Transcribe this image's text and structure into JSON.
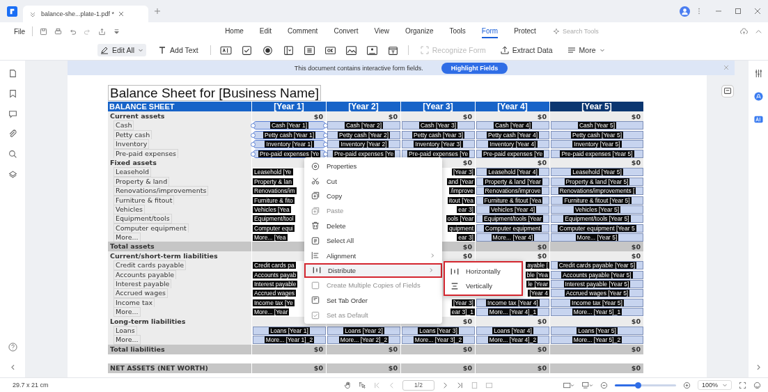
{
  "tab_title": "balance-she...plate-1.pdf *",
  "file_menu": "File",
  "menu": [
    {
      "label": "Home",
      "selected": false
    },
    {
      "label": "Edit",
      "selected": false
    },
    {
      "label": "Comment",
      "selected": false
    },
    {
      "label": "Convert",
      "selected": false
    },
    {
      "label": "View",
      "selected": false
    },
    {
      "label": "Organize",
      "selected": false
    },
    {
      "label": "Tools",
      "selected": false
    },
    {
      "label": "Form",
      "selected": true
    },
    {
      "label": "Protect",
      "selected": false
    }
  ],
  "search": {
    "placeholder": "Search Tools"
  },
  "toolbar": {
    "edit_all": "Edit All",
    "add_text": "Add Text",
    "recognize_form": {
      "label": "Recognize Form",
      "disabled": true
    },
    "extract_data": "Extract Data",
    "more": "More"
  },
  "notice": {
    "text": "This document contains interactive form fields.",
    "button": "Highlight Fields"
  },
  "document": {
    "title": "Balance Sheet for [Business Name]",
    "header": [
      "BALANCE SHEET",
      "[Year 1]",
      "[Year 2]",
      "[Year 3]",
      "[Year 4]",
      "[Year 5]"
    ],
    "rows": [
      {
        "kind": "section",
        "label": "Current assets",
        "values": [
          "$0",
          "$0",
          "$0",
          "$0",
          "$0"
        ]
      },
      {
        "kind": "item",
        "label": "Cash",
        "fields": [
          {
            "kind": "full",
            "text": "Cash [Year 1]",
            "selected": true
          },
          {
            "kind": "full",
            "text": "Cash [Year 2]",
            "selected": false
          },
          {
            "kind": "full",
            "text": "Cash [Year 3]",
            "selected": false
          },
          {
            "kind": "full",
            "text": "Cash [Year 4]",
            "selected": false
          },
          {
            "kind": "full",
            "text": "Cash [Year 5]",
            "selected": false
          }
        ]
      },
      {
        "kind": "item",
        "label": "Petty cash",
        "fields": [
          {
            "kind": "full",
            "text": "Petty cash [Year 1]",
            "selected": true
          },
          {
            "kind": "full",
            "text": "Petty cash [Year 2]",
            "selected": false
          },
          {
            "kind": "full",
            "text": "Petty cash [Year 3]",
            "selected": false
          },
          {
            "kind": "full",
            "text": "Petty cash [Year 4]",
            "selected": false
          },
          {
            "kind": "full",
            "text": "Petty cash [Year 5]",
            "selected": false
          }
        ]
      },
      {
        "kind": "item",
        "label": "Inventory",
        "fields": [
          {
            "kind": "full",
            "text": "Inventory [Year 1]",
            "selected": true
          },
          {
            "kind": "full",
            "text": "Inventory [Year 2]",
            "selected": false
          },
          {
            "kind": "full",
            "text": "Inventory [Year 3]",
            "selected": false
          },
          {
            "kind": "full",
            "text": "Inventory [Year 4]",
            "selected": false
          },
          {
            "kind": "full",
            "text": "Inventory [Year 5]",
            "selected": false
          }
        ]
      },
      {
        "kind": "item",
        "label": "Pre-paid expenses",
        "fields": [
          {
            "kind": "full",
            "text": "Pre-paid expenses [Ye",
            "selected": true
          },
          {
            "kind": "full",
            "text": "Pre-paid expenses [Ye",
            "selected": false
          },
          {
            "kind": "full",
            "text": "Pre-paid expenses [Ye",
            "selected": false
          },
          {
            "kind": "full",
            "text": "Pre-paid expenses [Ye",
            "selected": false
          },
          {
            "kind": "full",
            "text": "Pre-paid expenses [Year 5]",
            "selected": false
          }
        ]
      },
      {
        "kind": "section",
        "label": "Fixed assets",
        "values": [
          "$0",
          "$0",
          "$0"
        ]
      },
      {
        "kind": "item",
        "label": "Leasehold",
        "fields": [
          {
            "kind": "cut-end",
            "text": "Leasehold [Ye",
            "selected": false
          },
          {
            "kind": "covered"
          },
          {
            "kind": "cut-start",
            "text": "[Year 3]",
            "selected": false
          },
          {
            "kind": "full",
            "text": "Leasehold [Year 4]",
            "selected": false
          },
          {
            "kind": "full",
            "text": "Leasehold [Year 5]",
            "selected": false
          }
        ]
      },
      {
        "kind": "item",
        "label": "Property & land",
        "fields": [
          {
            "kind": "cut-end",
            "text": "Property & lan",
            "selected": false
          },
          {
            "kind": "covered"
          },
          {
            "kind": "cut-start",
            "text": "and [Year",
            "selected": false
          },
          {
            "kind": "full",
            "text": "Property & land [Year",
            "selected": false
          },
          {
            "kind": "full",
            "text": "Property & land [Year 5]",
            "selected": false
          }
        ]
      },
      {
        "kind": "item",
        "label": "Renovations/improvements",
        "fields": [
          {
            "kind": "cut-end",
            "text": "Renovations/im",
            "selected": false
          },
          {
            "kind": "covered"
          },
          {
            "kind": "cut-start",
            "text": "/improve",
            "selected": false
          },
          {
            "kind": "full",
            "text": "Renovations/improve",
            "selected": false
          },
          {
            "kind": "full",
            "text": "Renovations/improvements [",
            "selected": false
          }
        ]
      },
      {
        "kind": "item",
        "label": "Furniture & fitout",
        "fields": [
          {
            "kind": "cut-end",
            "text": "Furniture & fito",
            "selected": false
          },
          {
            "kind": "covered"
          },
          {
            "kind": "cut-start",
            "text": "itout [Yea",
            "selected": false
          },
          {
            "kind": "full",
            "text": "Furniture & fitout [Yea",
            "selected": false
          },
          {
            "kind": "full",
            "text": "Furniture & fitout [Year 5]",
            "selected": false
          }
        ]
      },
      {
        "kind": "item",
        "label": "Vehicles",
        "fields": [
          {
            "kind": "cut-end",
            "text": "Vehicles [Yea",
            "selected": false
          },
          {
            "kind": "covered"
          },
          {
            "kind": "cut-start",
            "text": "ear 3]",
            "selected": false
          },
          {
            "kind": "full",
            "text": "Vehicles [Year 4]",
            "selected": false
          },
          {
            "kind": "full",
            "text": "Vehicles [Year 5]",
            "selected": false
          }
        ]
      },
      {
        "kind": "item",
        "label": "Equipment/tools",
        "fields": [
          {
            "kind": "cut-end",
            "text": "Equipment/tool",
            "selected": false
          },
          {
            "kind": "covered"
          },
          {
            "kind": "cut-start",
            "text": "ools [Year",
            "selected": false
          },
          {
            "kind": "full",
            "text": "Equipment/tools [Year",
            "selected": false
          },
          {
            "kind": "full",
            "text": "Equipment/tools [Year 5]",
            "selected": false
          }
        ]
      },
      {
        "kind": "item",
        "label": "Computer equipment",
        "fields": [
          {
            "kind": "cut-end",
            "text": "Computer equi",
            "selected": false
          },
          {
            "kind": "covered"
          },
          {
            "kind": "cut-start",
            "text": "quipment",
            "selected": false
          },
          {
            "kind": "full",
            "text": "Computer equipment",
            "selected": false
          },
          {
            "kind": "full",
            "text": "Computer equipment [Year 5",
            "selected": false
          }
        ]
      },
      {
        "kind": "item",
        "label": "More...",
        "fields": [
          {
            "kind": "cut-end",
            "text": "More... [Yea",
            "selected": false
          },
          {
            "kind": "covered"
          },
          {
            "kind": "cut-start",
            "text": "ear 3]",
            "selected": false
          },
          {
            "kind": "full",
            "text": "More... [Year 4]",
            "selected": false
          },
          {
            "kind": "full",
            "text": "More... [Year 5]",
            "selected": false
          }
        ]
      },
      {
        "kind": "total",
        "label": "Total assets",
        "values": [
          "$0",
          "$0",
          "$0"
        ]
      },
      {
        "kind": "section",
        "label": "Current/short-term liabilities",
        "values": [
          "$0",
          "$0",
          "$0"
        ]
      },
      {
        "kind": "item",
        "label": "Credit cards payable",
        "fields": [
          {
            "kind": "cut-end",
            "text": "Credit cards pa",
            "selected": false
          },
          {
            "kind": "covered"
          },
          {
            "kind": "covered"
          },
          {
            "kind": "cut-start",
            "text": "ayable [",
            "selected": false
          },
          {
            "kind": "full",
            "text": "Credit cards payable [Year 5]",
            "selected": false
          }
        ]
      },
      {
        "kind": "item",
        "label": "Accounts payable",
        "fields": [
          {
            "kind": "cut-end",
            "text": "Accounts payab",
            "selected": false
          },
          {
            "kind": "covered"
          },
          {
            "kind": "covered"
          },
          {
            "kind": "cut-start",
            "text": "ble [Yea",
            "selected": false
          },
          {
            "kind": "full",
            "text": "Accounts payable [Year 5]",
            "selected": false
          }
        ]
      },
      {
        "kind": "item",
        "label": "Interest payable",
        "fields": [
          {
            "kind": "cut-end",
            "text": "Interest payable",
            "selected": false
          },
          {
            "kind": "covered"
          },
          {
            "kind": "covered"
          },
          {
            "kind": "cut-start",
            "text": "le [Year",
            "selected": false
          },
          {
            "kind": "full",
            "text": "Interest payable [Year 5]",
            "selected": false
          }
        ]
      },
      {
        "kind": "item",
        "label": "Accrued wages",
        "fields": [
          {
            "kind": "cut-end",
            "text": "Accrued wages",
            "selected": false
          },
          {
            "kind": "covered"
          },
          {
            "kind": "covered"
          },
          {
            "kind": "cut-start",
            "text": "[Year 4",
            "selected": false
          },
          {
            "kind": "full",
            "text": "Accrued wages [Year 5]",
            "selected": false
          }
        ]
      },
      {
        "kind": "item",
        "label": "Income tax",
        "fields": [
          {
            "kind": "cut-end",
            "text": "Income tax [Ye",
            "selected": false
          },
          {
            "kind": "covered"
          },
          {
            "kind": "cut-start",
            "text": "[Year 3]",
            "selected": false
          },
          {
            "kind": "full",
            "text": "Income tax [Year 4]",
            "selected": false
          },
          {
            "kind": "full",
            "text": "Income tax [Year 5]",
            "selected": false
          }
        ]
      },
      {
        "kind": "item",
        "label": "More...",
        "fields": [
          {
            "kind": "cut-end",
            "text": "More... [Year",
            "selected": false
          },
          {
            "kind": "covered"
          },
          {
            "kind": "cut-start",
            "text": "ear 3]_1",
            "selected": false
          },
          {
            "kind": "full",
            "text": "More... [Year 4]_1",
            "selected": false
          },
          {
            "kind": "full",
            "text": "More... [Year 5]_1",
            "selected": false
          }
        ]
      },
      {
        "kind": "section",
        "label": "Long-term liabilities",
        "values": [
          "$0",
          "$0",
          "$0"
        ]
      },
      {
        "kind": "item",
        "label": "Loans",
        "fields": [
          {
            "kind": "full",
            "text": "Loans [Year 1]",
            "selected": false
          },
          {
            "kind": "full",
            "text": "Loans [Year 2]",
            "selected": false
          },
          {
            "kind": "full",
            "text": "Loans [Year 3]",
            "selected": false
          },
          {
            "kind": "full",
            "text": "Loans [Year 4]",
            "selected": false
          },
          {
            "kind": "full",
            "text": "Loans [Year 5]",
            "selected": false
          }
        ]
      },
      {
        "kind": "item",
        "label": "More...",
        "fields": [
          {
            "kind": "full",
            "text": "More... [Year 1]_2",
            "selected": false
          },
          {
            "kind": "full",
            "text": "More... [Year 2]_2",
            "selected": false
          },
          {
            "kind": "full",
            "text": "More... [Year 3]_2",
            "selected": false
          },
          {
            "kind": "full",
            "text": "More... [Year 4]_2",
            "selected": false
          },
          {
            "kind": "full",
            "text": "More... [Year 5]_2",
            "selected": false
          }
        ]
      },
      {
        "kind": "total",
        "label": "Total liabilities",
        "values": [
          "$0",
          "$0",
          "$0",
          "$0",
          "$0"
        ]
      },
      {
        "kind": "spacer"
      },
      {
        "kind": "total",
        "label": "NET ASSETS (NET WORTH)",
        "values": [
          "$0",
          "$0",
          "$0",
          "$0",
          "$0"
        ]
      }
    ]
  },
  "context_menu": {
    "items": [
      {
        "label": "Properties",
        "kind": "properties",
        "disabled": false,
        "submenu": false,
        "highlighted": false
      },
      {
        "label": "Cut",
        "kind": "cut",
        "disabled": false,
        "submenu": false,
        "highlighted": false
      },
      {
        "label": "Copy",
        "kind": "copy",
        "disabled": false,
        "submenu": false,
        "highlighted": false
      },
      {
        "label": "Paste",
        "kind": "paste",
        "disabled": true,
        "submenu": false,
        "highlighted": false
      },
      {
        "label": "Delete",
        "kind": "delete",
        "disabled": false,
        "submenu": false,
        "highlighted": false
      },
      {
        "label": "Select All",
        "kind": "select-all",
        "disabled": false,
        "submenu": false,
        "highlighted": false
      },
      {
        "label": "Alignment",
        "kind": "alignment",
        "disabled": false,
        "submenu": true,
        "highlighted": false
      },
      {
        "label": "Distribute",
        "kind": "distribute",
        "disabled": false,
        "submenu": true,
        "highlighted": true
      },
      {
        "label": "Create Multiple Copies of Fields",
        "kind": "copies",
        "disabled": true,
        "submenu": false,
        "highlighted": false
      },
      {
        "label": "Set Tab Order",
        "kind": "tab-order",
        "disabled": false,
        "submenu": false,
        "highlighted": false
      },
      {
        "label": "Set as Default",
        "kind": "default",
        "disabled": true,
        "submenu": false,
        "highlighted": false
      }
    ],
    "submenu": {
      "highlighted": true,
      "items": [
        {
          "label": "Horizontally",
          "kind": "horizontal"
        },
        {
          "label": "Vertically",
          "kind": "vertical"
        }
      ]
    }
  },
  "status_bar": {
    "page_size": "29.7 x 21 cm",
    "page": "1/2",
    "zoom": "100%",
    "zoom_slider": {
      "level": 0.38
    }
  }
}
